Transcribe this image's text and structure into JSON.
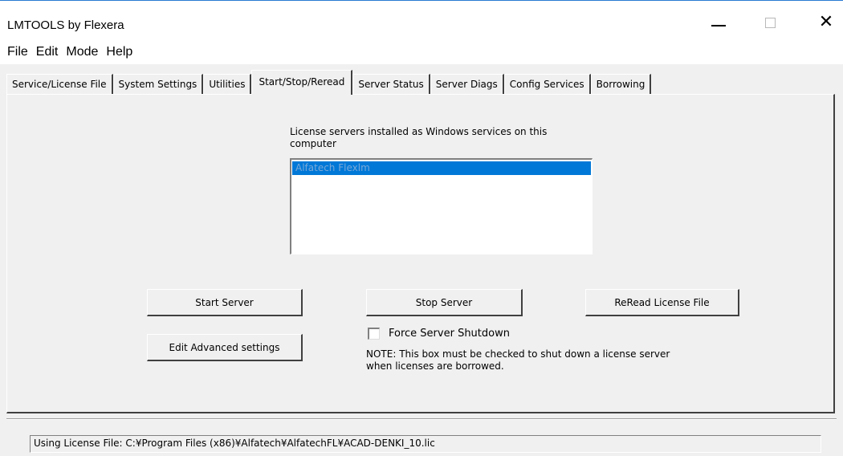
{
  "window": {
    "title": "LMTOOLS by Flexera",
    "minimize_icon": "minimize-icon",
    "maximize_icon": "maximize-icon",
    "close_icon": "close-icon",
    "close_glyph": "✕",
    "accent_color": "#2a7ad2"
  },
  "menu": [
    "File",
    "Edit",
    "Mode",
    "Help"
  ],
  "tabs": [
    {
      "label": "Service/License File",
      "active": false
    },
    {
      "label": "System Settings",
      "active": false
    },
    {
      "label": "Utilities",
      "active": false
    },
    {
      "label": "Start/Stop/Reread",
      "active": true
    },
    {
      "label": "Server Status",
      "active": false
    },
    {
      "label": "Server Diags",
      "active": false
    },
    {
      "label": "Config Services",
      "active": false
    },
    {
      "label": "Borrowing",
      "active": false
    }
  ],
  "panel": {
    "services_label_line1": "License servers installed as Windows services on this",
    "services_label_line2": "computer",
    "services": [
      {
        "name": "Alfatech Flexlm",
        "selected": true,
        "selected_color": "#0078d7"
      }
    ],
    "start_button": "Start Server",
    "stop_button": "Stop Server",
    "reread_button": "ReRead License File",
    "advanced_button": "Edit Advanced settings",
    "force_shutdown_label": "Force Server Shutdown",
    "force_shutdown_checked": false,
    "note_line1": "NOTE:  This box must be checked to shut down a license server",
    "note_line2": "when licenses are borrowed."
  },
  "status": {
    "text": "Using License File:  C:¥Program Files (x86)¥Alfatech¥AlfatechFL¥ACAD-DENKI_10.lic"
  }
}
